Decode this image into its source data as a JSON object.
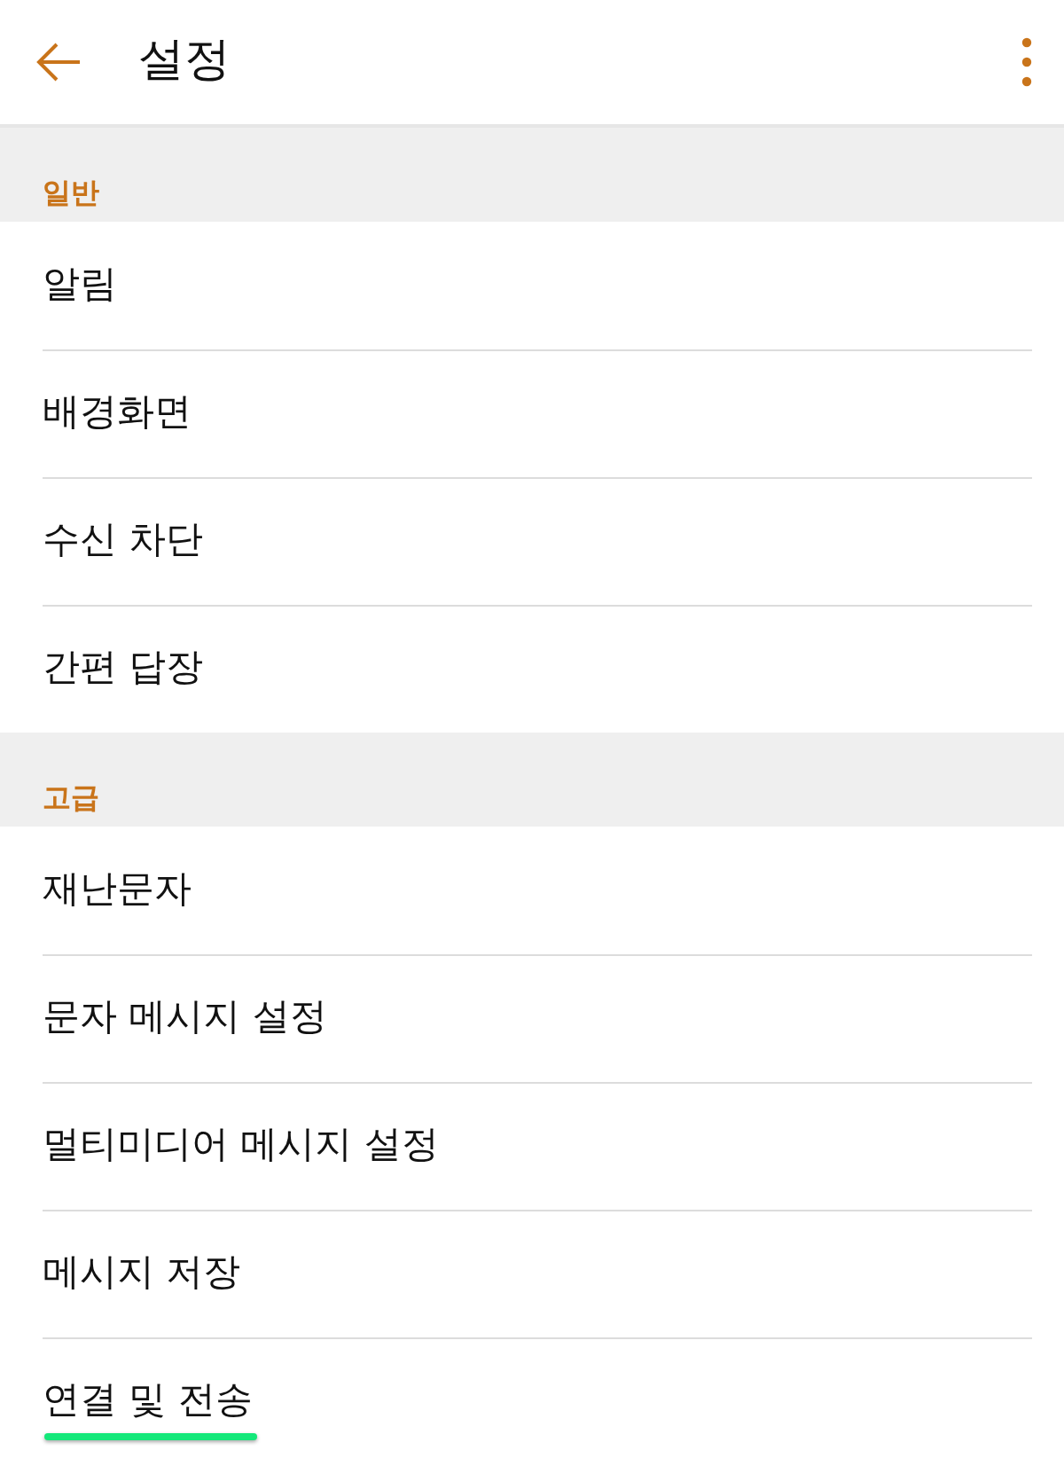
{
  "header": {
    "title": "설정"
  },
  "sections": [
    {
      "title": "일반",
      "items": [
        {
          "label": "알림",
          "highlighted": false
        },
        {
          "label": "배경화면",
          "highlighted": false
        },
        {
          "label": "수신 차단",
          "highlighted": false
        },
        {
          "label": "간편 답장",
          "highlighted": false
        }
      ]
    },
    {
      "title": "고급",
      "items": [
        {
          "label": "재난문자",
          "highlighted": false
        },
        {
          "label": "문자 메시지 설정",
          "highlighted": false
        },
        {
          "label": "멀티미디어 메시지 설정",
          "highlighted": false
        },
        {
          "label": "메시지 저장",
          "highlighted": false
        },
        {
          "label": "연결 및 전송",
          "highlighted": true
        }
      ]
    }
  ]
}
